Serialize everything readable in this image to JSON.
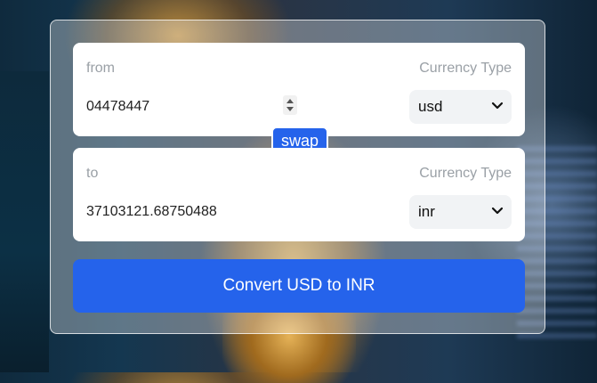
{
  "from": {
    "label": "from",
    "currency_type_label": "Currency Type",
    "amount": "04478447",
    "currency": "usd"
  },
  "to": {
    "label": "to",
    "currency_type_label": "Currency Type",
    "amount": "37103121.68750488",
    "currency": "inr"
  },
  "swap_label": "swap",
  "convert_label": "Convert USD to INR",
  "colors": {
    "accent": "#2563eb",
    "card": "#ffffff",
    "label": "#9aa0a6"
  },
  "icons": {
    "spinner": "number-spinner-icon",
    "select": "chevron-down-icon"
  }
}
